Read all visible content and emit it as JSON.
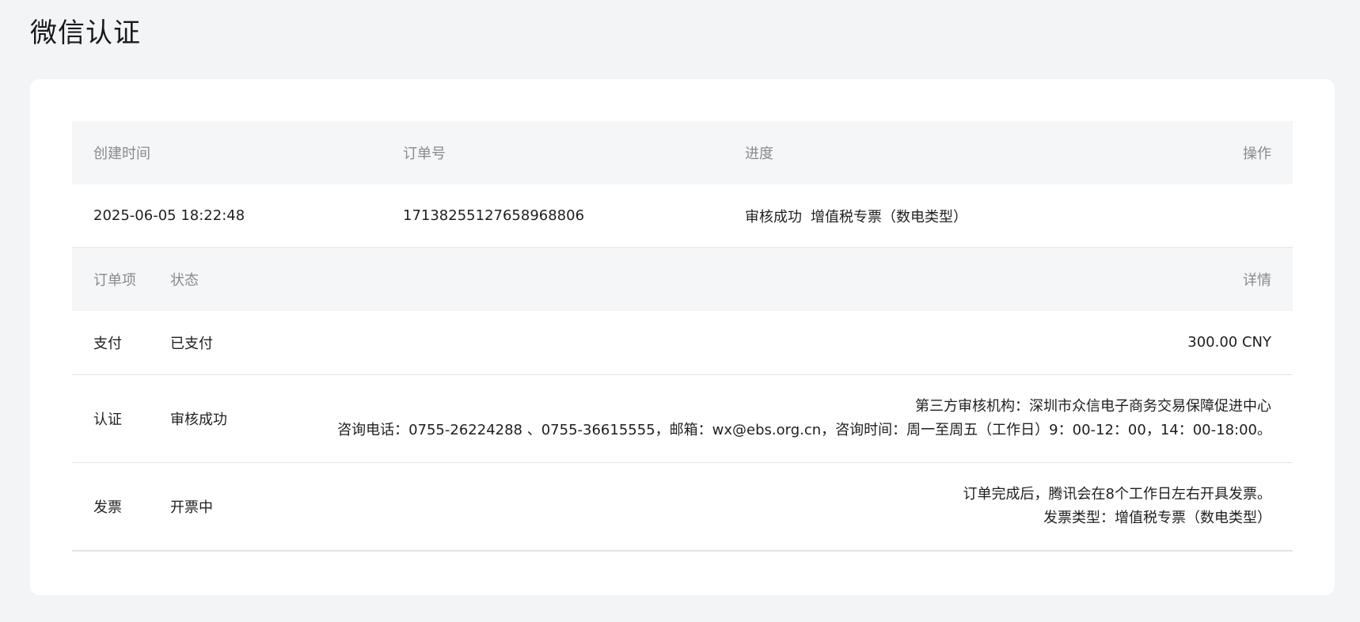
{
  "page": {
    "title": "微信认证"
  },
  "order_table": {
    "headers": {
      "created": "创建时间",
      "order_no": "订单号",
      "progress": "进度",
      "action": "操作"
    },
    "row": {
      "created": "2025-06-05 18:22:48",
      "order_no": "1713825512765896880​6",
      "progress_status": "审核成功",
      "progress_type": "增值税专票（数电类型）"
    }
  },
  "items_table": {
    "headers": {
      "item": "订单项",
      "status": "状态",
      "detail": "详情"
    },
    "rows": [
      {
        "item": "支付",
        "status": "已支付",
        "detail_lines": [
          "300.00 CNY"
        ]
      },
      {
        "item": "认证",
        "status": "审核成功",
        "detail_lines": [
          "第三方审核机构：深圳市众信电子商务交易保障促进中心",
          "咨询电话：0755-26224288 、0755-36615555，邮箱：wx@ebs.org.cn，咨询时间：周一至周五（工作日）9：00-12：00，14：00-18:00。"
        ]
      },
      {
        "item": "发票",
        "status": "开票中",
        "detail_lines": [
          "订单完成后，腾讯会在8个工作日左右开具发票。",
          "发票类型：增值税专票（数电类型）"
        ]
      }
    ]
  },
  "colors": {
    "page_background": "#f3f4f6",
    "card_background": "#ffffff",
    "header_background": "#f5f6f8",
    "header_text": "#8a8a8a",
    "body_text": "#1f1f1f",
    "divider": "#e6e6e6"
  }
}
